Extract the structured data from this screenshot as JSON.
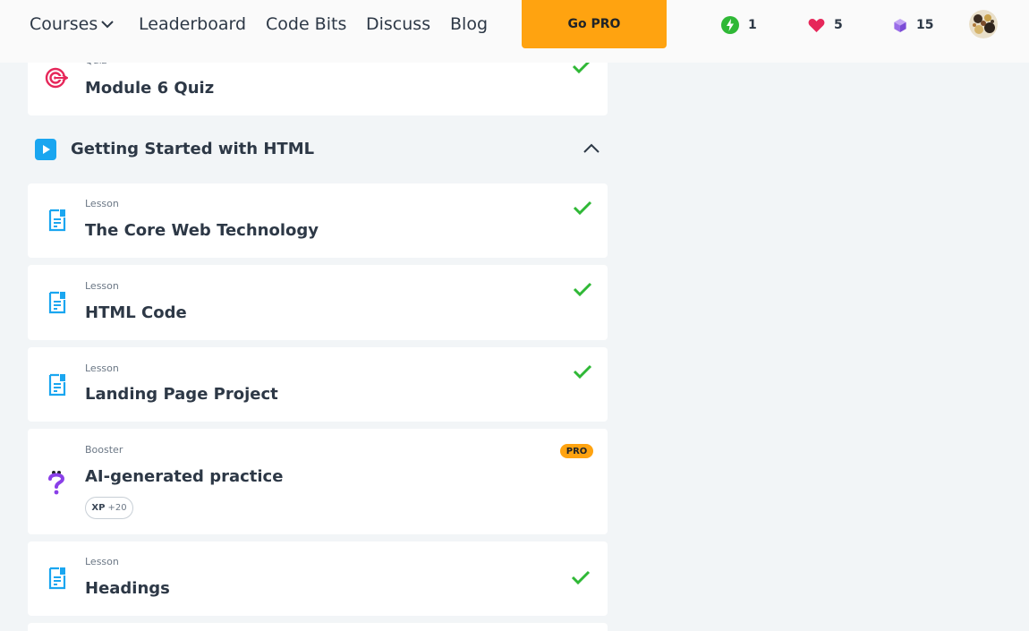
{
  "nav": {
    "courses_label": "Courses",
    "leaderboard_label": "Leaderboard",
    "codebits_label": "Code Bits",
    "discuss_label": "Discuss",
    "blog_label": "Blog",
    "gopro_label": "Go PRO",
    "streak_count": "1",
    "hearts_count": "5",
    "bits_count": "15"
  },
  "colors": {
    "accent_orange": "#ffa310",
    "check_green": "#2fb836",
    "lesson_blue": "#1aa6f0",
    "quiz_pink": "#e6275a",
    "booster_purple": "#8a3fe8"
  },
  "quiz_card": {
    "type_label": "Quiz",
    "title": "Module 6 Quiz",
    "icon": "target-icon",
    "completed": true
  },
  "section": {
    "title": "Getting Started with HTML",
    "icon": "play-icon",
    "expanded": true
  },
  "lessons": [
    {
      "type_label": "Lesson",
      "title": "The Core Web Technology",
      "icon": "document-icon",
      "completed": true
    },
    {
      "type_label": "Lesson",
      "title": "HTML Code",
      "icon": "document-icon",
      "completed": true
    },
    {
      "type_label": "Lesson",
      "title": "Landing Page Project",
      "icon": "document-icon",
      "completed": true
    }
  ],
  "booster": {
    "type_label": "Booster",
    "title": "AI-generated practice",
    "badge": "PRO",
    "xp_label": "XP",
    "xp_value": "+20",
    "icon": "question-icon"
  },
  "headings_card": {
    "type_label": "Lesson",
    "title": "Headings",
    "icon": "document-icon",
    "completed": true
  }
}
